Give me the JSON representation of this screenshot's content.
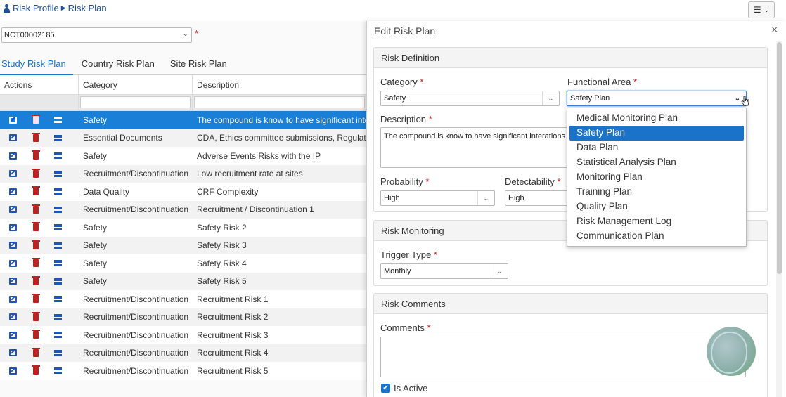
{
  "breadcrumb": {
    "items": [
      "Risk Profile",
      "Risk Plan"
    ]
  },
  "header": {
    "menu_icon": "hamburger-icon",
    "menu_caret": "chevron-down-icon"
  },
  "study_selector": {
    "value": "NCT00002185",
    "required_mark": "*"
  },
  "tabs": [
    {
      "label": "Study Risk Plan",
      "active": true
    },
    {
      "label": "Country Risk Plan",
      "active": false
    },
    {
      "label": "Site Risk Plan",
      "active": false
    }
  ],
  "grid": {
    "columns": [
      "Actions",
      "Category",
      "Description"
    ],
    "rows": [
      {
        "category": "Safety",
        "description": "The compound is know to have significant intera",
        "selected": true
      },
      {
        "category": "Essential Documents",
        "description": "CDA, Ethics committee submissions, Regulatory"
      },
      {
        "category": "Safety",
        "description": "Adverse Events Risks with the IP"
      },
      {
        "category": "Recruitment/Discontinuation",
        "description": "Low recruitment rate at sites"
      },
      {
        "category": "Data Quailty",
        "description": "CRF Complexity"
      },
      {
        "category": "Recruitment/Discontinuation",
        "description": "Recruitment / Discontinuation 1"
      },
      {
        "category": "Safety",
        "description": "Safety Risk 2"
      },
      {
        "category": "Safety",
        "description": "Safety Risk 3"
      },
      {
        "category": "Safety",
        "description": "Safety Risk 4"
      },
      {
        "category": "Safety",
        "description": "Safety Risk 5"
      },
      {
        "category": "Recruitment/Discontinuation",
        "description": "Recruitment Risk 1"
      },
      {
        "category": "Recruitment/Discontinuation",
        "description": "Recruitment Risk 2"
      },
      {
        "category": "Recruitment/Discontinuation",
        "description": "Recruitment Risk 3"
      },
      {
        "category": "Recruitment/Discontinuation",
        "description": "Recruitment Risk 4"
      },
      {
        "category": "Recruitment/Discontinuation",
        "description": "Recruitment Risk 5"
      }
    ]
  },
  "panel": {
    "title": "Edit Risk Plan",
    "close": "×",
    "risk_definition": {
      "heading": "Risk Definition",
      "category_label": "Category",
      "category_value": "Safety",
      "functional_area_label": "Functional Area",
      "functional_area_value": "Safety Plan",
      "description_label": "Description",
      "description_value": "The compound is know to have significant interations w",
      "probability_label": "Probability",
      "probability_value": "High",
      "detectability_label": "Detectability",
      "detectability_value": "High",
      "req": "*"
    },
    "risk_monitoring": {
      "heading": "Risk Monitoring",
      "trigger_label": "Trigger Type",
      "trigger_value": "Monthly"
    },
    "risk_comments": {
      "heading": "Risk Comments",
      "comments_label": "Comments",
      "comments_value": "",
      "is_active_label": "Is Active",
      "is_active": true
    }
  },
  "functional_area_options": [
    "Medical Monitoring Plan",
    "Safety Plan",
    "Data Plan",
    "Statistical Analysis Plan",
    "Monitoring Plan",
    "Training Plan",
    "Quality Plan",
    "Risk Management Log",
    "Communication Plan"
  ],
  "functional_area_selected_index": 1,
  "colors": {
    "accent": "#1a73c8",
    "link": "#1a4f9c",
    "required": "#d21b1b",
    "selected_row": "#1a7fd6"
  }
}
